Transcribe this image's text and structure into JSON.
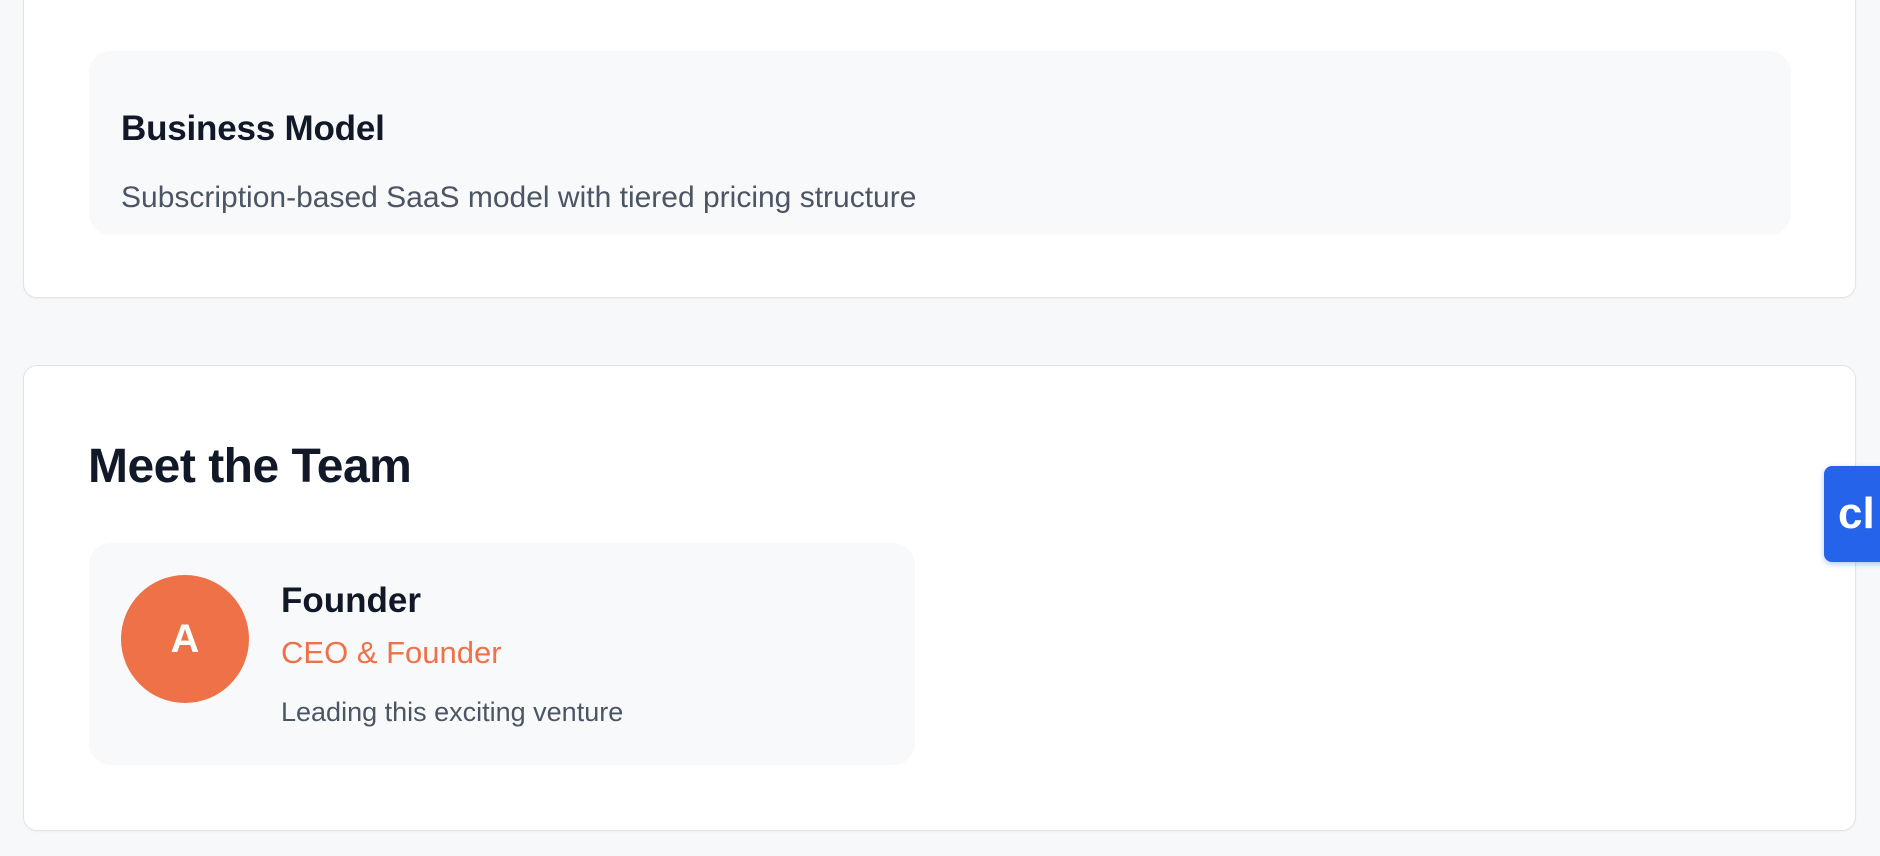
{
  "overview": {
    "business_model": {
      "title": "Business Model",
      "text": "Subscription-based SaaS model with tiered pricing structure"
    }
  },
  "team": {
    "heading": "Meet the Team",
    "members": [
      {
        "initial": "A",
        "name": "Founder",
        "role": "CEO & Founder",
        "description": "Leading this exciting venture"
      }
    ]
  },
  "chat_widget": {
    "label": "cl"
  },
  "colors": {
    "accent": "#ef7148",
    "chat": "#2563eb",
    "heading": "#111827",
    "muted_text": "#4b5563",
    "page_bg": "#f7f8fa"
  }
}
